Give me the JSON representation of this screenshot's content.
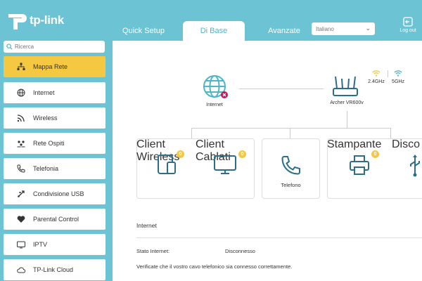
{
  "brand": {
    "logo_text": "tp-link"
  },
  "nav": {
    "tabs": [
      {
        "label": "Quick Setup"
      },
      {
        "label": "Di Base"
      },
      {
        "label": "Avanzate"
      }
    ],
    "language": "Italiano",
    "logout_label": "Log out"
  },
  "sidebar": {
    "search_placeholder": "Ricerca",
    "items": [
      {
        "label": "Mappa Rete",
        "icon": "network-map-icon"
      },
      {
        "label": "Internet",
        "icon": "globe-icon"
      },
      {
        "label": "Wireless",
        "icon": "wifi-icon"
      },
      {
        "label": "Rete Ospiti",
        "icon": "guest-network-icon"
      },
      {
        "label": "Telefonia",
        "icon": "phone-icon"
      },
      {
        "label": "Condivisione USB",
        "icon": "usb-icon"
      },
      {
        "label": "Parental Control",
        "icon": "heart-icon"
      },
      {
        "label": "IPTV",
        "icon": "tv-icon"
      },
      {
        "label": "TP-Link Cloud",
        "icon": "cloud-icon"
      }
    ]
  },
  "map": {
    "internet_label": "Internet",
    "router_label": "Archer VR600v",
    "band_24": "2.4GHz",
    "band_5": "5GHz",
    "cards": [
      {
        "label": "Client Wireless",
        "badge": "0"
      },
      {
        "label": "Client Cablati",
        "badge": "0"
      },
      {
        "label": "Telefono",
        "badge": ""
      },
      {
        "label": "Stampante",
        "badge": "0"
      },
      {
        "label": "Disco USB",
        "badge": ""
      }
    ]
  },
  "status": {
    "section_title": "Internet",
    "state_label": "Stato Internet:",
    "state_value": "Disconnesso",
    "note": "Verificate che il vostro cavo telefonico sia connesso correttamente."
  },
  "colors": {
    "accent": "#6cc3d3",
    "active_menu": "#f5c842",
    "icon": "#2a6f8a",
    "error": "#c2185b"
  }
}
